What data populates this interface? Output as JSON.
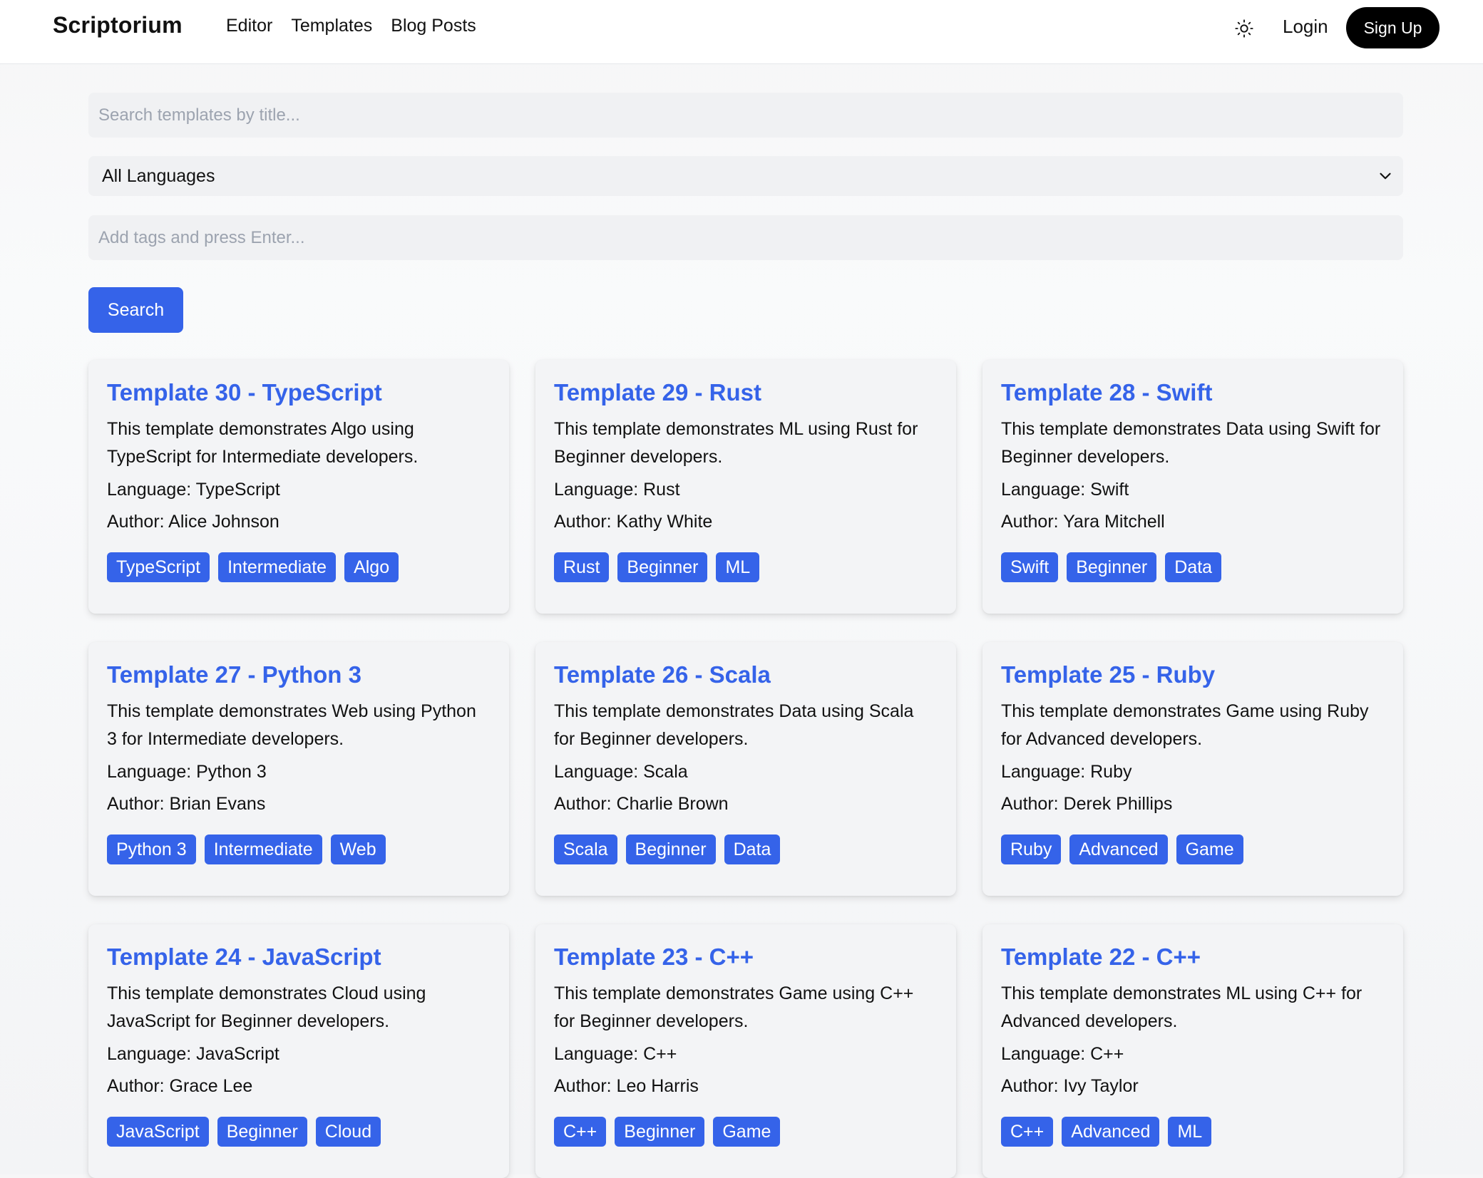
{
  "nav": {
    "brand": "Scriptorium",
    "links": [
      "Editor",
      "Templates",
      "Blog Posts"
    ],
    "theme_icon": "sun-icon",
    "login": "Login",
    "signup": "Sign Up"
  },
  "filters": {
    "search_placeholder": "Search templates by title...",
    "language_selected": "All Languages",
    "tags_placeholder": "Add tags and press Enter...",
    "search_button": "Search"
  },
  "colors": {
    "accent": "#3563e9",
    "card_bg": "#f3f4f6",
    "signup_bg": "#000000"
  },
  "cards": [
    {
      "title": "Template 30 - TypeScript",
      "description": "This template demonstrates Algo using TypeScript for Intermediate developers.",
      "language": "Language: TypeScript",
      "author": "Author: Alice Johnson",
      "tags": [
        "TypeScript",
        "Intermediate",
        "Algo"
      ]
    },
    {
      "title": "Template 29 - Rust",
      "description": "This template demonstrates ML using Rust for Beginner developers.",
      "language": "Language: Rust",
      "author": "Author: Kathy White",
      "tags": [
        "Rust",
        "Beginner",
        "ML"
      ]
    },
    {
      "title": "Template 28 - Swift",
      "description": "This template demonstrates Data using Swift for Beginner developers.",
      "language": "Language: Swift",
      "author": "Author: Yara Mitchell",
      "tags": [
        "Swift",
        "Beginner",
        "Data"
      ]
    },
    {
      "title": "Template 27 - Python 3",
      "description": "This template demonstrates Web using Python 3 for Intermediate developers.",
      "language": "Language: Python 3",
      "author": "Author: Brian Evans",
      "tags": [
        "Python 3",
        "Intermediate",
        "Web"
      ]
    },
    {
      "title": "Template 26 - Scala",
      "description": "This template demonstrates Data using Scala for Beginner developers.",
      "language": "Language: Scala",
      "author": "Author: Charlie Brown",
      "tags": [
        "Scala",
        "Beginner",
        "Data"
      ]
    },
    {
      "title": "Template 25 - Ruby",
      "description": "This template demonstrates Game using Ruby for Advanced developers.",
      "language": "Language: Ruby",
      "author": "Author: Derek Phillips",
      "tags": [
        "Ruby",
        "Advanced",
        "Game"
      ]
    },
    {
      "title": "Template 24 - JavaScript",
      "description": "This template demonstrates Cloud using JavaScript for Beginner developers.",
      "language": "Language: JavaScript",
      "author": "Author: Grace Lee",
      "tags": [
        "JavaScript",
        "Beginner",
        "Cloud"
      ]
    },
    {
      "title": "Template 23 - C++",
      "description": "This template demonstrates Game using C++ for Beginner developers.",
      "language": "Language: C++",
      "author": "Author: Leo Harris",
      "tags": [
        "C++",
        "Beginner",
        "Game"
      ]
    },
    {
      "title": "Template 22 - C++",
      "description": "This template demonstrates ML using C++ for Advanced developers.",
      "language": "Language: C++",
      "author": "Author: Ivy Taylor",
      "tags": [
        "C++",
        "Advanced",
        "ML"
      ]
    }
  ]
}
